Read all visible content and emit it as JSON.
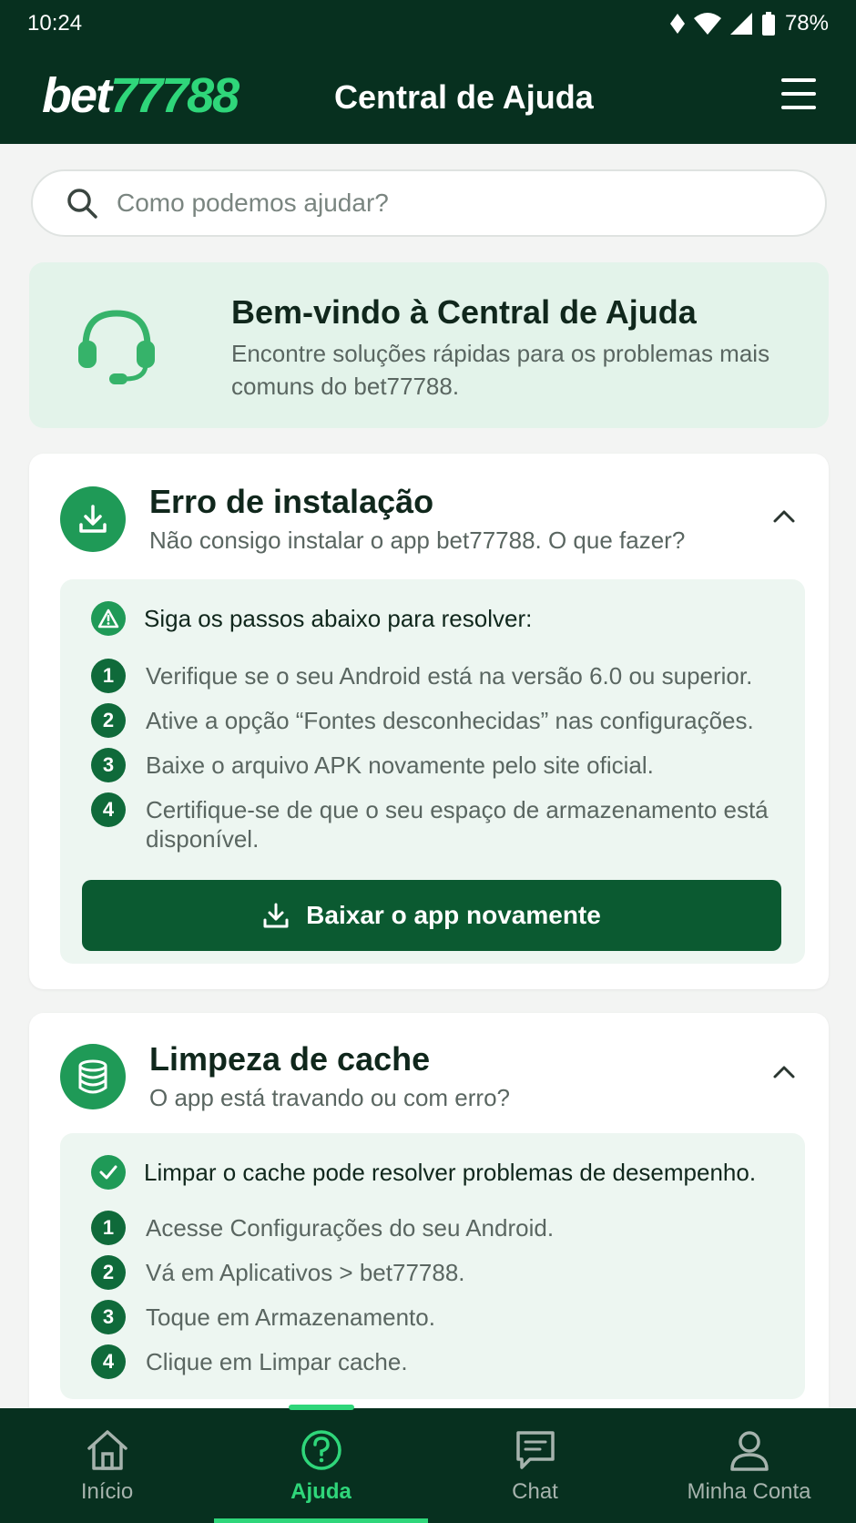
{
  "status_bar": {
    "time": "10:24",
    "battery": "78%"
  },
  "header": {
    "logo_prefix": "bet",
    "logo_number": "77788",
    "title": "Central de Ajuda"
  },
  "search": {
    "placeholder": "Como podemos ajudar?",
    "value": ""
  },
  "welcome": {
    "title": "Bem-vindo à Central de Ajuda",
    "text": "Encontre soluções rápidas para os problemas mais comuns do bet77788.",
    "icon": "headset-icon"
  },
  "cards": [
    {
      "title": "Erro de instalação",
      "subtitle": "Não consigo instalar o app bet77788. O que fazer?",
      "icon": "download-icon",
      "intro": "Siga os passos abaixo para resolver:",
      "intro_icon": "warning-icon",
      "steps": [
        {
          "n": "1",
          "text": "Verifique se o seu Android está na versão 6.0 ou superior."
        },
        {
          "n": "2",
          "text": "Ative a opção “Fontes desconhecidas” nas configurações."
        },
        {
          "n": "3",
          "text": "Baixe o arquivo APK novamente pelo site oficial."
        },
        {
          "n": "4",
          "text": "Certifique-se de que o seu espaço de armazenamento está disponível."
        }
      ],
      "button": "Baixar o app novamente"
    },
    {
      "title": "Limpeza de cache",
      "subtitle": "O app está travando ou com erro?",
      "icon": "database-icon",
      "intro": "Limpar o cache pode resolver problemas de desempenho.",
      "intro_icon": "check-circle-icon",
      "steps": [
        {
          "n": "1",
          "text": "Acesse Configurações do seu Android."
        },
        {
          "n": "2",
          "text": "Vá em Aplicativos > bet77788."
        },
        {
          "n": "3",
          "text": "Toque em Armazenamento."
        },
        {
          "n": "4",
          "text": "Clique em Limpar cache."
        }
      ]
    }
  ],
  "bottom_nav": [
    {
      "label": "Início",
      "icon": "home-icon",
      "active": false
    },
    {
      "label": "Ajuda",
      "icon": "help-icon",
      "active": true
    },
    {
      "label": "Chat",
      "icon": "chat-icon",
      "active": false
    },
    {
      "label": "Minha Conta",
      "icon": "user-icon",
      "active": false
    }
  ],
  "colors": {
    "brand_dark": "#07301f",
    "accent": "#2fd67a",
    "green": "#1f9a57",
    "button": "#0b5a31"
  }
}
